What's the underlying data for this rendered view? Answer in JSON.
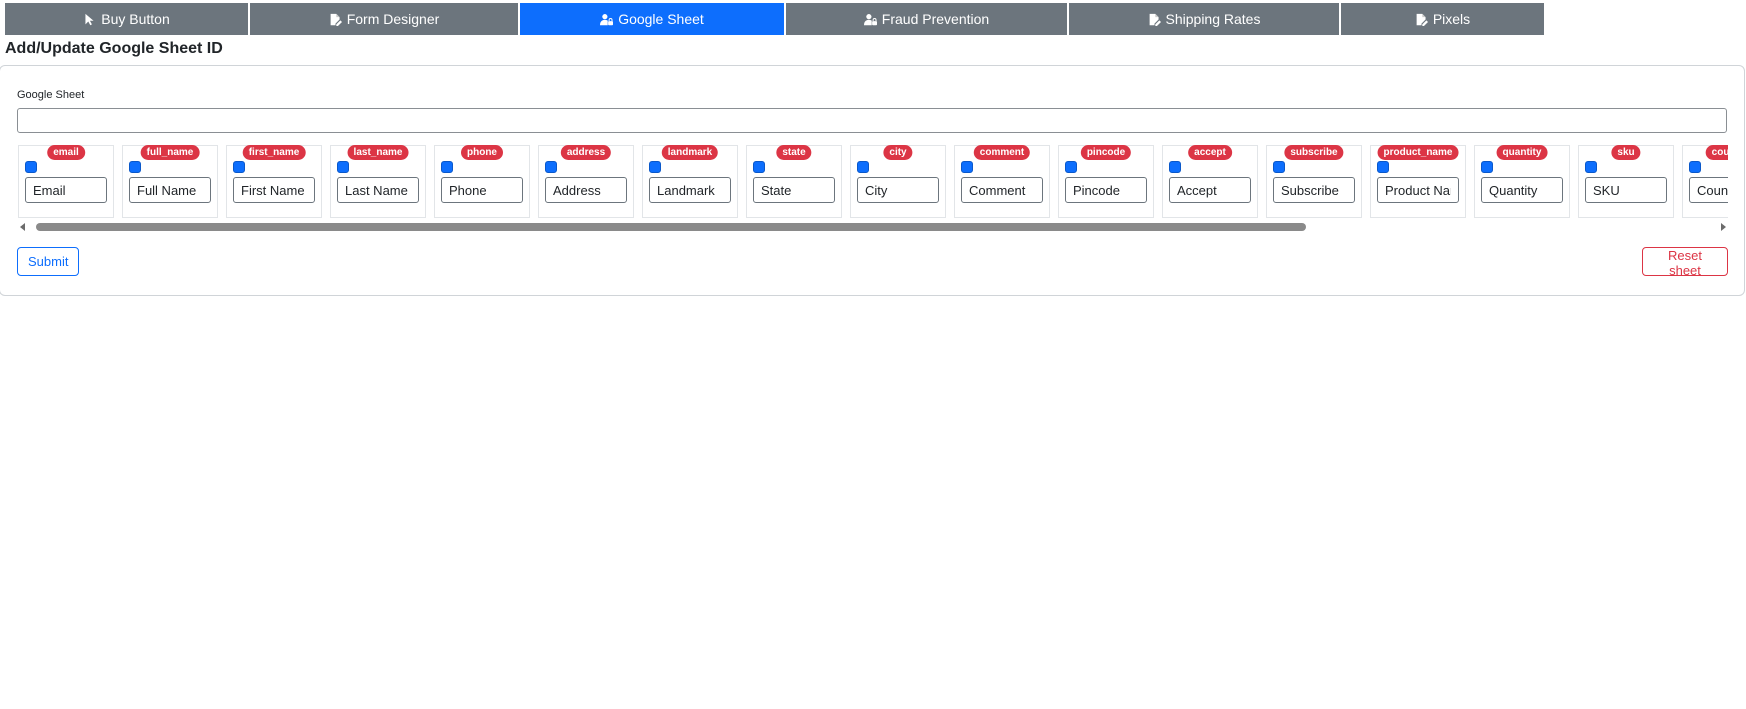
{
  "tabs": [
    {
      "label": "Buy Button",
      "icon": "cursor-icon",
      "active": false
    },
    {
      "label": "Form Designer",
      "icon": "file-edit-icon",
      "active": false
    },
    {
      "label": "Google Sheet",
      "icon": "user-lock-icon",
      "active": true
    },
    {
      "label": "Fraud Prevention",
      "icon": "user-lock-icon",
      "active": false
    },
    {
      "label": "Shipping Rates",
      "icon": "file-edit-icon",
      "active": false
    },
    {
      "label": "Pixels",
      "icon": "file-edit-icon",
      "active": false
    }
  ],
  "page_title": "Add/Update Google Sheet ID",
  "google_sheet": {
    "label": "Google Sheet",
    "value": ""
  },
  "fields": [
    {
      "key": "email",
      "value": "Email",
      "checked": true
    },
    {
      "key": "full_name",
      "value": "Full Name",
      "checked": true
    },
    {
      "key": "first_name",
      "value": "First Name",
      "checked": true
    },
    {
      "key": "last_name",
      "value": "Last Name",
      "checked": true
    },
    {
      "key": "phone",
      "value": "Phone",
      "checked": true
    },
    {
      "key": "address",
      "value": "Address",
      "checked": true
    },
    {
      "key": "landmark",
      "value": "Landmark",
      "checked": true
    },
    {
      "key": "state",
      "value": "State",
      "checked": true
    },
    {
      "key": "city",
      "value": "City",
      "checked": true
    },
    {
      "key": "comment",
      "value": "Comment",
      "checked": true
    },
    {
      "key": "pincode",
      "value": "Pincode",
      "checked": true
    },
    {
      "key": "accept",
      "value": "Accept",
      "checked": true
    },
    {
      "key": "subscribe",
      "value": "Subscribe",
      "checked": true
    },
    {
      "key": "product_name",
      "value": "Product Name",
      "checked": true
    },
    {
      "key": "quantity",
      "value": "Quantity",
      "checked": true
    },
    {
      "key": "sku",
      "value": "SKU",
      "checked": true
    },
    {
      "key": "country",
      "value": "Country",
      "checked": true
    }
  ],
  "buttons": {
    "submit_label": "Submit",
    "reset_label": "Reset sheet"
  },
  "colors": {
    "tab_default": "#6c757d",
    "tab_active": "#0d6efd",
    "badge": "#dc3545",
    "submit": "#0d6efd",
    "reset": "#dc3545"
  }
}
